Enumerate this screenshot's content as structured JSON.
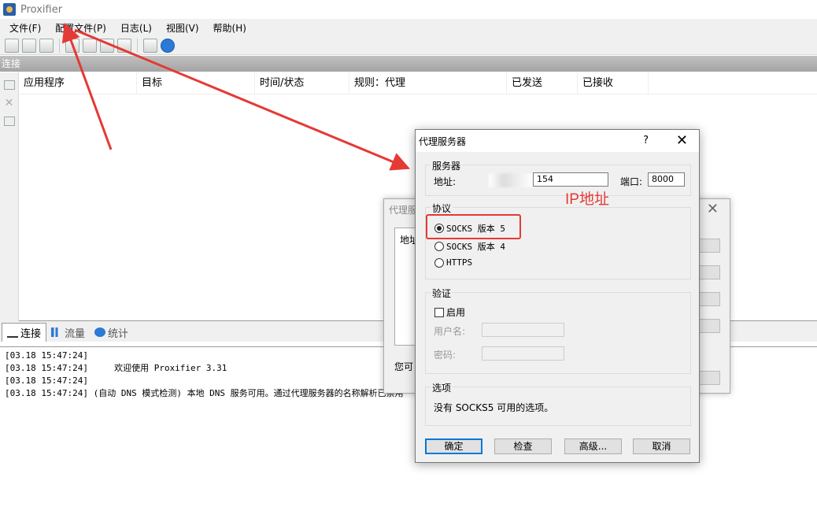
{
  "window": {
    "title": "Proxifier"
  },
  "menu": [
    "文件(F)",
    "配置文件(P)",
    "日志(L)",
    "视图(V)",
    "帮助(H)"
  ],
  "toolbar_icons": [
    "profile-icon",
    "proxy-servers-icon",
    "rules-icon",
    "new-icon",
    "open-icon",
    "save-icon",
    "import-icon",
    "print-icon",
    "help-icon"
  ],
  "section_header": "连接",
  "columns": [
    "应用程序",
    "目标",
    "时间/状态",
    "规则：代理",
    "已发送",
    "已接收"
  ],
  "tabs": [
    "连接",
    "流量",
    "统计"
  ],
  "log": [
    "[03.18 15:47:24]",
    "[03.18 15:47:24]     欢迎使用 Proxifier 3.31",
    "[03.18 15:47:24]",
    "[03.18 15:47:24] (自动 DNS 模式检测) 本地 DNS 服务可用。通过代理服务器的名称解析已禁用"
  ],
  "bg_dialog": {
    "title": "代理服",
    "panel_text": "地址",
    "note": "您可"
  },
  "dialog": {
    "title": "代理服务器",
    "help": "?",
    "close": "✕",
    "server_group": "服务器",
    "address_label": "地址:",
    "address_value": "154",
    "port_label": "端口:",
    "port_value": "8000",
    "protocol_group": "协议",
    "protocols": [
      {
        "label": "SOCKS 版本 5",
        "checked": true
      },
      {
        "label": "SOCKS 版本 4",
        "checked": false
      },
      {
        "label": "HTTPS",
        "checked": false
      }
    ],
    "auth_group": "验证",
    "enable_label": "启用",
    "username_label": "用户名:",
    "password_label": "密码:",
    "options_group": "选项",
    "options_text": "没有 SOCKS5 可用的选项。",
    "buttons": {
      "ok": "确定",
      "check": "检查",
      "advanced": "高级...",
      "cancel": "取消"
    }
  },
  "annotation": {
    "text": "IP地址",
    "color": "#e53935"
  }
}
